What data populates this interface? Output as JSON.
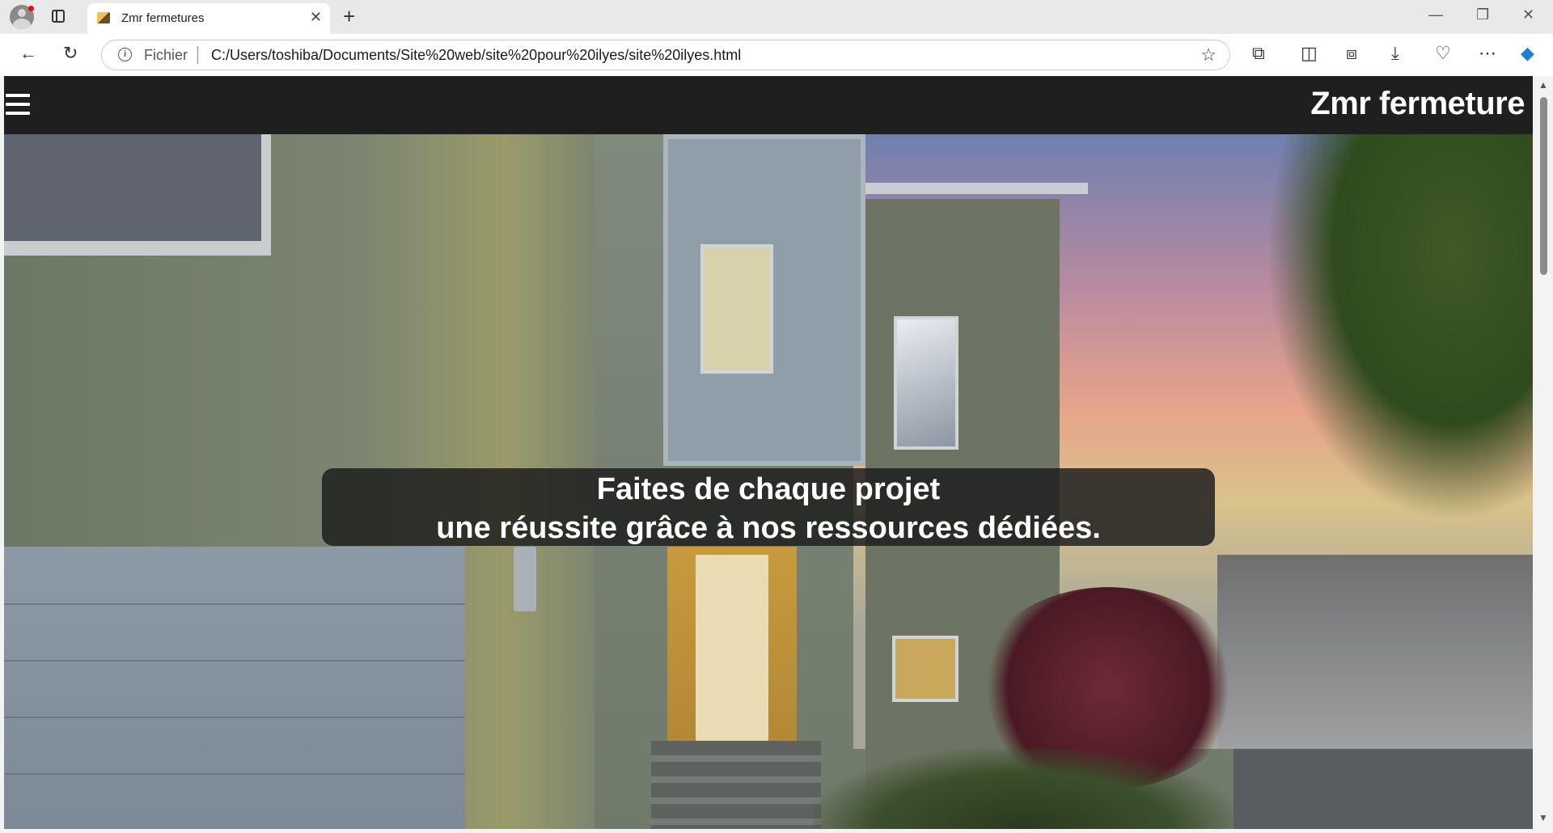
{
  "browser": {
    "tab_title": "Zmr fermetures",
    "tab_close": "✕",
    "new_tab": "+",
    "window_controls": {
      "minimize": "—",
      "restore": "❐",
      "close": "✕"
    },
    "scheme_label": "Fichier",
    "url": "C:/Users/toshiba/Documents/Site%20web/site%20pour%20ilyes/site%20ilyes.html",
    "icons": {
      "back": "←",
      "refresh": "↻",
      "info": "i",
      "favorite": "☆",
      "extensions": "⧉",
      "split_screen": "◫",
      "collections": "⧈",
      "downloads": "⤓",
      "browser_essentials": "♡",
      "more": "⋯",
      "copilot": "◆"
    }
  },
  "site": {
    "brand": "Zmr fermeture",
    "tagline_line1": "Faites de chaque projet",
    "tagline_line2": "une réussite grâce à nos ressources dédiées."
  },
  "colors": {
    "header_bg": "#1f1f1f",
    "tagline_bg": "#1e1e1e",
    "text_light": "#ffffff",
    "copilot_accent": "#1b7fd6"
  }
}
